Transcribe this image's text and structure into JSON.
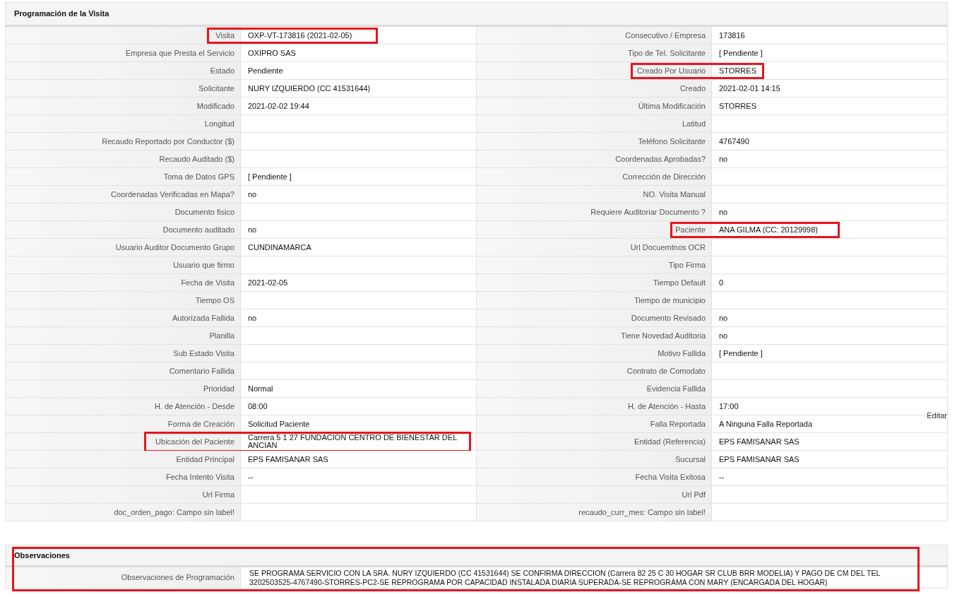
{
  "section": {
    "title": "Programación de la Visita"
  },
  "rows": [
    [
      {
        "label": "Visita",
        "value": "OXP-VT-173816 (2021-02-05)",
        "highlighted": true
      },
      {
        "label": "Consecutivo / Empresa",
        "value": "173816",
        "highlighted": false
      }
    ],
    [
      {
        "label": "Empresa que Presta el Servicio",
        "value": "OXIPRO SAS",
        "highlighted": false
      },
      {
        "label": "Tipo de Tel. Solicitante",
        "value": "[ Pendiente ]",
        "highlighted": false
      }
    ],
    [
      {
        "label": "Estado",
        "value": "Pendiente",
        "highlighted": false
      },
      {
        "label": "Creado Por Usuario",
        "value": "STORRES",
        "highlighted": true
      }
    ],
    [
      {
        "label": "Solicitante",
        "value": "NURY IZQUIERDO (CC 41531644)",
        "highlighted": false
      },
      {
        "label": "Creado",
        "value": "2021-02-01 14:15",
        "highlighted": false
      }
    ],
    [
      {
        "label": "Modificado",
        "value": "2021-02-02 19:44",
        "highlighted": false
      },
      {
        "label": "Última Modificación",
        "value": "STORRES",
        "highlighted": false
      }
    ],
    [
      {
        "label": "Longitud",
        "highlighted": false
      },
      {
        "label": "Latitud",
        "highlighted": false
      }
    ],
    [
      {
        "label": "Recaudo Reportado por Conductor ($)",
        "highlighted": false
      },
      {
        "label": "Teléfono Solicitante",
        "value": "4767490",
        "highlighted": false
      }
    ],
    [
      {
        "label": "Recaudo Auditado ($)",
        "highlighted": false
      },
      {
        "label": "Coordenadas Aprobadas?",
        "value": "no",
        "highlighted": false
      }
    ],
    [
      {
        "label": "Toma de Datos GPS",
        "value": "[ Pendiente ]",
        "highlighted": false
      },
      {
        "label": "Corrección de Dirección",
        "highlighted": false
      }
    ],
    [
      {
        "label": "Coordenadas Verificadas en Mapa?",
        "value": "no",
        "highlighted": false
      },
      {
        "label": "NO. Visita Manual",
        "highlighted": false
      }
    ],
    [
      {
        "label": "Documento fisico",
        "highlighted": false
      },
      {
        "label": "Requiere Auditoriar Documento ?",
        "value": "no",
        "highlighted": false
      }
    ],
    [
      {
        "label": "Documento auditado",
        "value": "no",
        "highlighted": false
      },
      {
        "label": "Paciente",
        "value": "ANA GILMA (CC: 20129998)",
        "highlighted": true
      }
    ],
    [
      {
        "label": "Usuario Auditor Documento Grupo",
        "value": "CUNDINAMARCA",
        "highlighted": false
      },
      {
        "label": "Url Docuemtnos OCR",
        "highlighted": false
      }
    ],
    [
      {
        "label": "Usuario que firmo",
        "highlighted": false
      },
      {
        "label": "Tipo Firma",
        "highlighted": false
      }
    ],
    [
      {
        "label": "Fecha de Visita",
        "value": "2021-02-05",
        "highlighted": false
      },
      {
        "label": "Tiempo Default",
        "value": "0",
        "highlighted": false
      }
    ],
    [
      {
        "label": "Tiempo OS",
        "highlighted": false
      },
      {
        "label": "Tiempo de municipio",
        "highlighted": false
      }
    ],
    [
      {
        "label": "Autorizada Fallida",
        "value": "no",
        "highlighted": false
      },
      {
        "label": "Documento Revisado",
        "value": "no",
        "highlighted": false
      }
    ],
    [
      {
        "label": "Planilla",
        "highlighted": false
      },
      {
        "label": "Tiene Novedad Auditoria",
        "value": "no",
        "highlighted": false
      }
    ],
    [
      {
        "label": "Sub Estado Visita",
        "highlighted": false
      },
      {
        "label": "Motivo Fallida",
        "value": "[ Pendiente ]",
        "highlighted": false
      }
    ],
    [
      {
        "label": "Comentario Fallida",
        "highlighted": false
      },
      {
        "label": "Contrato de Comodato",
        "highlighted": false
      }
    ],
    [
      {
        "label": "Prioridad",
        "value": "Normal",
        "highlighted": false
      },
      {
        "label": "Evidencia Fallida",
        "highlighted": false
      }
    ],
    [
      {
        "label": "H. de Atención - Desde",
        "value": "08:00",
        "highlighted": false
      },
      {
        "label": "H. de Atención - Hasta",
        "value": "17:00",
        "highlighted": false
      }
    ],
    [
      {
        "label": "Forma de Creación",
        "value": "Solicitud Paciente",
        "highlighted": false
      },
      {
        "label": "Falla Reportada",
        "value": "A Ninguna Falla Reportada",
        "link": "Editar",
        "highlighted": false
      }
    ],
    [
      {
        "label": "Ubicación del Paciente",
        "value": "Carrera 5 1 27 FUNDACION CENTRO DE BIENESTAR DEL ANCIAN",
        "highlighted": true
      },
      {
        "label": "Entidad (Referencia)",
        "value": "EPS FAMISANAR SAS",
        "highlighted": false
      }
    ],
    [
      {
        "label": "Entidad Principal",
        "value": "EPS FAMISANAR SAS",
        "highlighted": false
      },
      {
        "label": "Sucursal",
        "value": "EPS FAMISANAR SAS",
        "highlighted": false
      }
    ],
    [
      {
        "label": "Fecha Intento Visita",
        "value": "--",
        "highlighted": false
      },
      {
        "label": "Fecha Visita Exitosa",
        "value": "--",
        "highlighted": false
      }
    ],
    [
      {
        "label": "Url Firma",
        "highlighted": false
      },
      {
        "label": "Url Pdf",
        "highlighted": false
      }
    ],
    [
      {
        "label": "doc_orden_pago: Campo sin label!",
        "highlighted": false
      },
      {
        "label": "recaudo_curr_mes: Campo sin label!",
        "highlighted": false
      }
    ]
  ],
  "observaciones": {
    "title": "Observaciones",
    "label": "Observaciones de Programación",
    "value": "SE PROGRAMA SERVICIO CON LA SRA. NURY IZQUIERDO (CC 41531644) SE CONFIRMA DIRECCION (Carrera 82 25 C 30 HOGAR SR CLUB BRR MODELIA) Y PAGO DE CM DEL TEL 3202503525-4767490-STORRES-PC2-SE REPROGRAMA POR CAPACIDAD INSTALADA DIARIA SUPERADA-SE REPROGRAMA CON MARY (ENCARGADA DEL HOGAR)",
    "highlighted": true
  }
}
